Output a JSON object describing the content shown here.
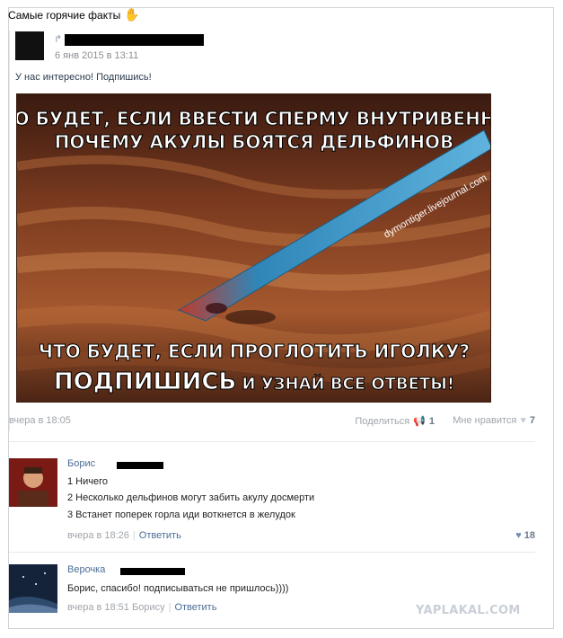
{
  "header": {
    "title": "Самые горячие факты",
    "emoji": "✋"
  },
  "post": {
    "date": "6 янв 2015 в 13:11",
    "text": "У нас интересно! Подпишись!",
    "image": {
      "top_line_1": "ЧТО БУДЕТ, ЕСЛИ ВВЕСТИ СПЕРМУ ВНУТРИВЕННО?",
      "top_line_2": "ПОЧЕМУ АКУЛЫ БОЯТСЯ ДЕЛЬФИНОВ",
      "watermark": "dymontiger.livejournal.com",
      "bottom_line_1": "ЧТО БУДЕТ, ЕСЛИ ПРОГЛОТИТЬ ИГОЛКУ?",
      "bottom_line_2a": "ПОДПИШИСЬ",
      "bottom_line_2b": " И УЗНАЙ ВСЕ ОТВЕТЫ!"
    },
    "time": "вчера в 18:05",
    "share_label": "Поделиться",
    "share_count": "1",
    "like_label": "Мне нравится",
    "like_count": "7"
  },
  "comments": [
    {
      "name": "Борис",
      "lines": [
        "1 Ничего",
        "2 Несколько дельфинов могут забить акулу досмерти",
        "3 Встанет поперек горла иди воткнется в желудок"
      ],
      "time": "вчера в 18:26",
      "reply_label": "Ответить",
      "likes": "18"
    },
    {
      "name": "Верочка",
      "lines": [
        "Борис, спасибо! подписываться не пришлось))))"
      ],
      "time": "вчера в 18:51 Борису",
      "reply_label": "Ответить"
    }
  ],
  "site_watermark": "YAPLAKAL.COM",
  "colors": {
    "link": "#4b6d93",
    "needle": "#3a93c2",
    "tissue": "#9a4a2a"
  }
}
